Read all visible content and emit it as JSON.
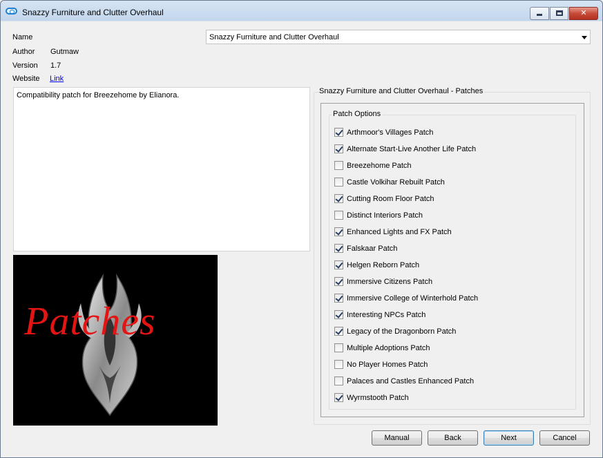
{
  "window": {
    "title": "Snazzy Furniture and Clutter Overhaul",
    "minimize_symbol": "",
    "maximize_symbol": "",
    "close_symbol": "✕"
  },
  "info": {
    "name_label": "Name",
    "name_value": "Snazzy Furniture and Clutter Overhaul",
    "author_label": "Author",
    "author_value": "Gutmaw",
    "version_label": "Version",
    "version_value": "1.7",
    "website_label": "Website",
    "website_link": "Link"
  },
  "description": "Compatibility patch for Breezehome by Elianora.",
  "preview": {
    "text": "Patches"
  },
  "patches_group": {
    "title": "Snazzy Furniture and Clutter Overhaul - Patches",
    "options_title": "Patch Options",
    "items": [
      {
        "label": "Arthmoor's Villages Patch",
        "checked": true
      },
      {
        "label": "Alternate Start-Live Another Life Patch",
        "checked": true
      },
      {
        "label": "Breezehome Patch",
        "checked": false
      },
      {
        "label": "Castle Volkihar Rebuilt Patch",
        "checked": false
      },
      {
        "label": "Cutting Room Floor Patch",
        "checked": true
      },
      {
        "label": "Distinct Interiors Patch",
        "checked": false
      },
      {
        "label": "Enhanced Lights and FX Patch",
        "checked": true
      },
      {
        "label": "Falskaar Patch",
        "checked": true
      },
      {
        "label": "Helgen Reborn Patch",
        "checked": true
      },
      {
        "label": "Immersive Citizens Patch",
        "checked": true
      },
      {
        "label": "Immersive College of Winterhold Patch",
        "checked": true
      },
      {
        "label": "Interesting NPCs Patch",
        "checked": true
      },
      {
        "label": "Legacy of the Dragonborn Patch",
        "checked": true
      },
      {
        "label": "Multiple Adoptions Patch",
        "checked": false
      },
      {
        "label": "No Player Homes Patch",
        "checked": false
      },
      {
        "label": "Palaces and Castles Enhanced Patch",
        "checked": false
      },
      {
        "label": "Wyrmstooth Patch",
        "checked": true
      }
    ]
  },
  "buttons": {
    "manual": "Manual",
    "back": "Back",
    "next": "Next",
    "cancel": "Cancel"
  }
}
